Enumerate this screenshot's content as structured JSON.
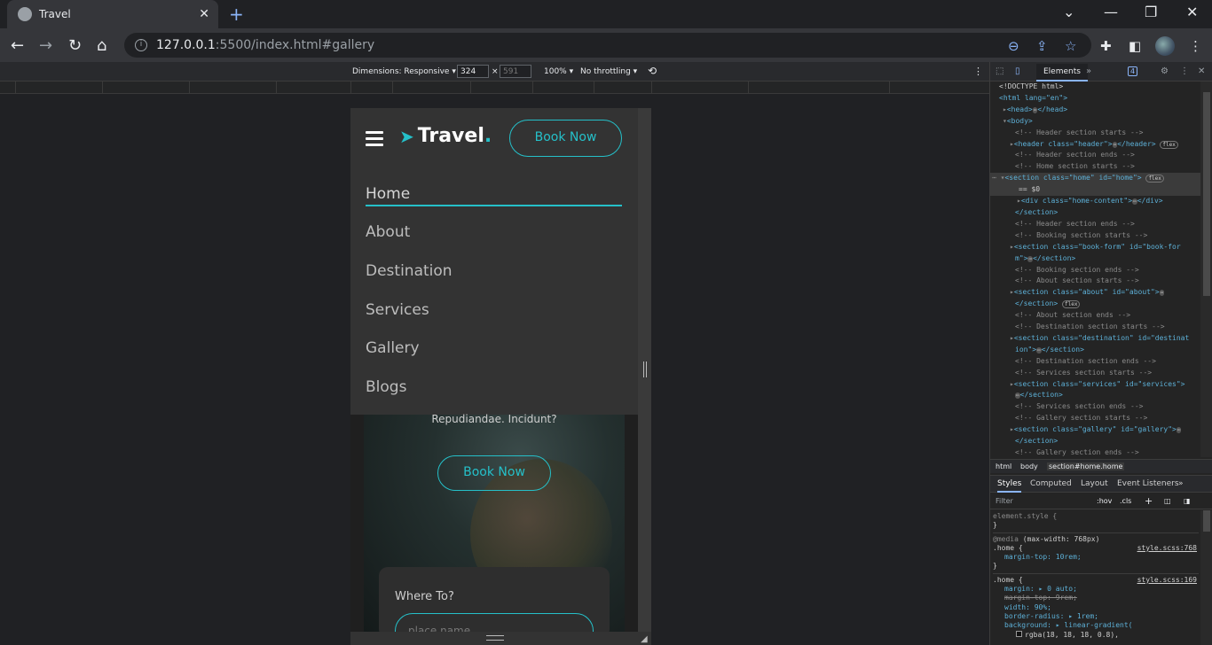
{
  "browser": {
    "tab_title": "Travel",
    "url_host": "127.0.0.1",
    "url_rest": ":5500/index.html#gallery"
  },
  "device_toolbar": {
    "dimensions": "Dimensions: Responsive ▾",
    "width": "324",
    "height": "591",
    "times": "×",
    "zoom": "100% ▾",
    "throttling": "No throttling ▾"
  },
  "site": {
    "logo": "Travel",
    "logo_dot": ".",
    "header_button": "Book Now",
    "menu": [
      "Home",
      "About",
      "Destination",
      "Services",
      "Gallery",
      "Blogs"
    ],
    "home_text": "Repudiandae. Incidunt?",
    "home_button": "Book Now",
    "form_label": "Where To?",
    "form_placeholder": "place name"
  },
  "devtools": {
    "active_tab": "Elements",
    "issues_count": "4",
    "breadcrumbs": [
      "html",
      "body",
      "section#home.home"
    ],
    "style_tabs": [
      "Styles",
      "Computed",
      "Layout",
      "Event Listeners"
    ],
    "filter_placeholder": "Filter",
    "hov": ":hov",
    "cls": ".cls",
    "dom": {
      "doctype": "<!DOCTYPE html>",
      "html_open": "<html lang=\"en\">",
      "head": "<head>",
      "head_close": "</head>",
      "body_open": "<body>",
      "c_header_start": "<!-- Header section starts -->",
      "header_tag": "<header class=\"header\">",
      "header_close": "</header>",
      "c_header_end": "<!-- Header section ends -->",
      "c_home_start": "<!-- Home section starts -->",
      "home_section": "<section class=\"home\" id=\"home\">",
      "eq": "== $0",
      "home_content": "<div class=\"home-content\">",
      "div_close": "</div>",
      "section_close": "</section>",
      "c_header_end2": "<!-- Header section ends -->",
      "c_booking_start": "<!-- Booking section starts -->",
      "book_form_a": "<section class=\"book-form\" id=\"book-for",
      "book_form_b": "m\">",
      "c_booking_end": "<!-- Booking section ends -->",
      "c_about_start": "<!-- About section starts -->",
      "about_section": "<section class=\"about\" id=\"about\">",
      "c_about_end": "<!-- About section ends -->",
      "c_dest_start": "<!-- Destination section starts -->",
      "dest_a": "<section class=\"destination\" id=\"destinat",
      "dest_b": "ion\">",
      "c_dest_end": "<!-- Destination section ends -->",
      "c_serv_start": "<!-- Services section starts -->",
      "serv_section": "<section class=\"services\" id=\"services\">",
      "c_serv_end": "<!-- Services section ends -->",
      "c_gal_start": "<!-- Gallery section starts -->",
      "gal_section": "<section class=\"gallery\" id=\"gallery\">",
      "c_gal_end": "<!-- Gallery section ends -->",
      "flex_badge": "flex",
      "ellipsis": "⋯",
      "more": "⋯"
    },
    "styles": {
      "element_style": "element.style {",
      "close_brace": "}",
      "media": "@media",
      "media_cond": "(max-width: 768px)",
      "home_sel": ".home {",
      "link1": "style.scss:768",
      "margin_top": "margin-top: 10rem;",
      "link2": "style.scss:169",
      "margin": "margin: ▸ 0 auto;",
      "margin_top_old": "margin-top: 9rem;",
      "width": "width: 90%;",
      "radius": "border-radius: ▸ 1rem;",
      "background": "background: ▸ linear-gradient(",
      "rgba": "rgba(18, 18, 18, 0.8),"
    }
  }
}
